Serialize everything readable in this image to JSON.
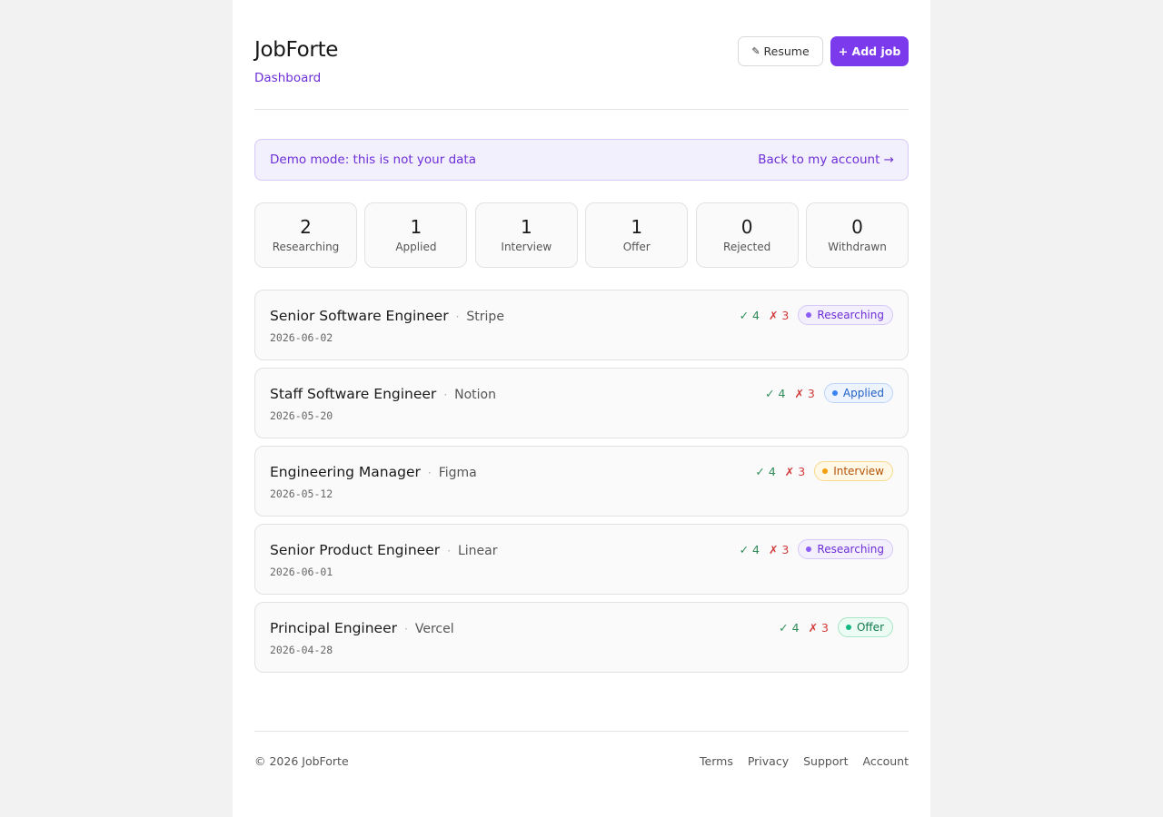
{
  "header": {
    "brand": "JobForte",
    "subnav": "Dashboard",
    "resume_icon": "pencil-icon",
    "resume_label": "Resume",
    "add_label": "+ Add job"
  },
  "banner": {
    "text": "Demo mode: this is not your data",
    "link": "Back to my account →"
  },
  "stats": [
    {
      "value": "2",
      "label": "Researching"
    },
    {
      "value": "1",
      "label": "Applied"
    },
    {
      "value": "1",
      "label": "Interview"
    },
    {
      "value": "1",
      "label": "Offer"
    },
    {
      "value": "0",
      "label": "Rejected"
    },
    {
      "value": "0",
      "label": "Withdrawn"
    }
  ],
  "jobs": [
    {
      "title": "Senior Software Engineer",
      "company": "Stripe",
      "date": "2026-06-02",
      "pass": "✓ 4",
      "fail": "✗ 3",
      "status": "Researching",
      "status_key": "researching"
    },
    {
      "title": "Staff Software Engineer",
      "company": "Notion",
      "date": "2026-05-20",
      "pass": "✓ 4",
      "fail": "✗ 3",
      "status": "Applied",
      "status_key": "applied"
    },
    {
      "title": "Engineering Manager",
      "company": "Figma",
      "date": "2026-05-12",
      "pass": "✓ 4",
      "fail": "✗ 3",
      "status": "Interview",
      "status_key": "interview"
    },
    {
      "title": "Senior Product Engineer",
      "company": "Linear",
      "date": "2026-06-01",
      "pass": "✓ 4",
      "fail": "✗ 3",
      "status": "Researching",
      "status_key": "researching"
    },
    {
      "title": "Principal Engineer",
      "company": "Vercel",
      "date": "2026-04-28",
      "pass": "✓ 4",
      "fail": "✗ 3",
      "status": "Offer",
      "status_key": "offer"
    }
  ],
  "status_colors": {
    "researching": {
      "fg": "#6d2fd6",
      "bg": "#f3effd",
      "border": "#d6c8f8",
      "dot": "#8b5cf6"
    },
    "applied": {
      "fg": "#2160c4",
      "bg": "#eef4fe",
      "border": "#bcd3f7",
      "dot": "#3b82f6"
    },
    "interview": {
      "fg": "#b45309",
      "bg": "#fff8e6",
      "border": "#f5d98c",
      "dot": "#f59e0b"
    },
    "offer": {
      "fg": "#0f7a4e",
      "bg": "#ecfbf3",
      "border": "#a7e6c6",
      "dot": "#10b981"
    }
  },
  "footer": {
    "copyright": "© 2026 JobForte",
    "links": [
      "Terms",
      "Privacy",
      "Support",
      "Account"
    ]
  }
}
